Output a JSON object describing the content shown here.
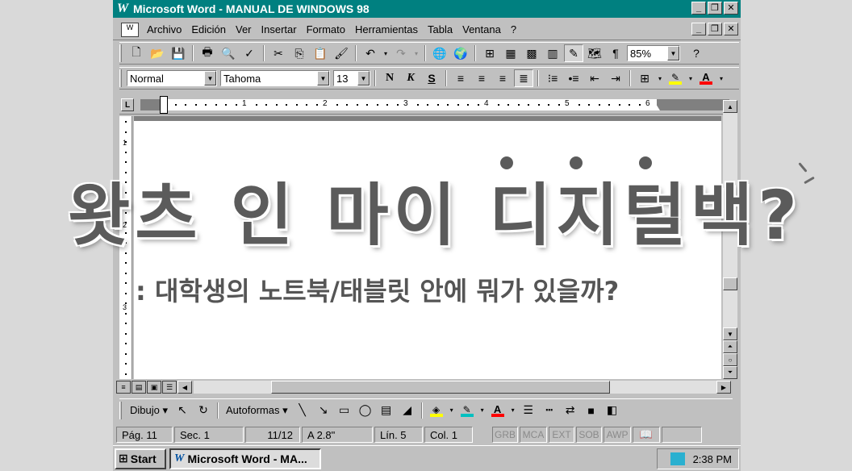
{
  "window": {
    "title": "Microsoft Word - MANUAL DE WINDOWS 98",
    "app_icon": "W",
    "controls": [
      "_",
      "🗗",
      "✕"
    ]
  },
  "menu": {
    "items": [
      "Archivo",
      "Edición",
      "Ver",
      "Insertar",
      "Formato",
      "Herramientas",
      "Tabla",
      "Ventana",
      "?"
    ]
  },
  "toolbar_standard": {
    "zoom": "85%"
  },
  "toolbar_format": {
    "style": "Normal",
    "font": "Tahoma",
    "size": "13",
    "bold": "N",
    "italic": "K",
    "underline": "S"
  },
  "ruler": {
    "tab_selector": "L",
    "numbers": [
      "1",
      "2",
      "3",
      "4",
      "5",
      "6"
    ],
    "vnumbers": [
      "1",
      "2",
      "3"
    ]
  },
  "drawing_toolbar": {
    "draw_label": "Dibujo",
    "autoshapes_label": "Autoformas"
  },
  "status": {
    "page": "Pág. 11",
    "section": "Sec. 1",
    "pages": "11/12",
    "at": "A 2.8\"",
    "line": "Lín. 5",
    "col": "Col. 1",
    "modes": [
      "GRB",
      "MCA",
      "EXT",
      "SOB",
      "AWP"
    ]
  },
  "taskbar": {
    "start": "Start",
    "task": "Microsoft Word - MA...",
    "time": "2:38 PM"
  },
  "overlay": {
    "headline": "왓츠 인 마이 디지털백?",
    "subtitle": ": 대학생의 노트북/태블릿 안에 뭐가 있을까?"
  },
  "colors": {
    "titlebar": "#008080",
    "highlight_yellow": "#ffff00",
    "font_red": "#ff0000",
    "overlay_text": "#5b5b5b"
  }
}
